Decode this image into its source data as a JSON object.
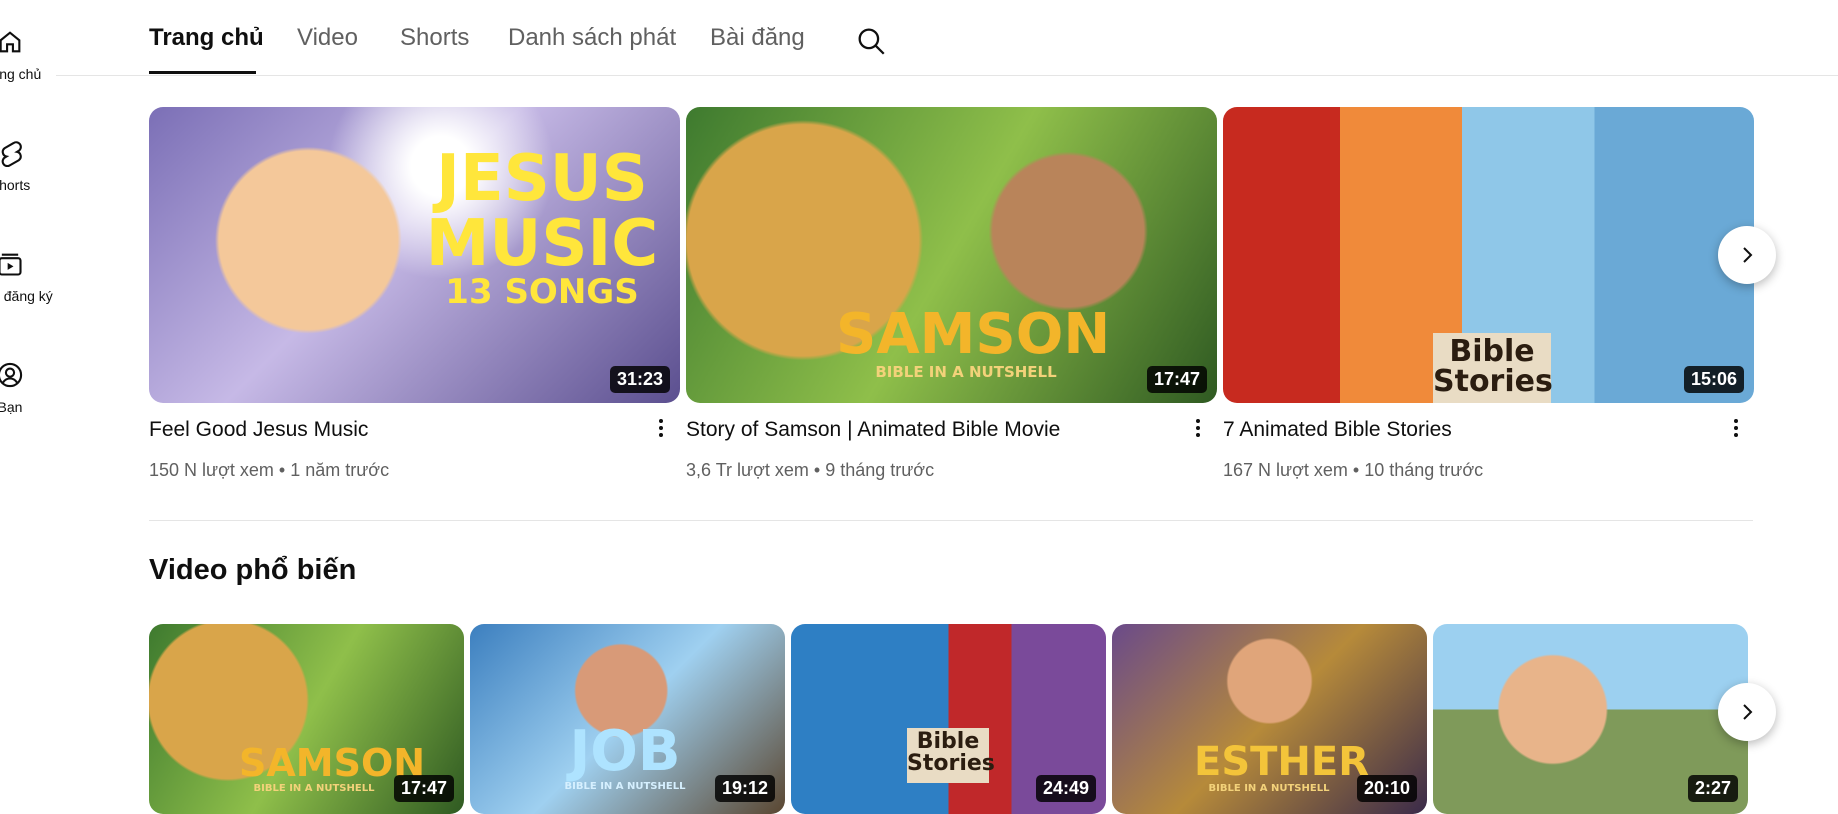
{
  "sidebar": {
    "items": [
      {
        "label": "Trang chủ",
        "icon": "home-icon"
      },
      {
        "label": "Shorts",
        "icon": "shorts-icon"
      },
      {
        "label": "Kênh đăng ký",
        "icon": "subscriptions-icon"
      },
      {
        "label": "Bạn",
        "icon": "you-icon"
      }
    ]
  },
  "tabs": [
    {
      "label": "Trang chủ",
      "active": true
    },
    {
      "label": "Video",
      "active": false
    },
    {
      "label": "Shorts",
      "active": false
    },
    {
      "label": "Danh sách phát",
      "active": false
    },
    {
      "label": "Bài đăng",
      "active": false
    }
  ],
  "featured": [
    {
      "title": "Feel Good Jesus Music",
      "views": "150 N lượt xem",
      "age": "1 năm trước",
      "duration": "31:23",
      "art_line1": "JESUS",
      "art_line2": "MUSIC",
      "art_line3": "13 SONGS"
    },
    {
      "title": "Story of Samson | Animated Bible Movie",
      "views": "3,6 Tr lượt xem",
      "age": "9 tháng trước",
      "duration": "17:47",
      "art_line1": "SAMSON",
      "art_line2": "BIBLE IN A NUTSHELL"
    },
    {
      "title": "7 Animated Bible Stories",
      "views": "167 N lượt xem",
      "age": "10 tháng trước",
      "duration": "15:06",
      "art_line1": "Bible",
      "art_line2": "Stories"
    }
  ],
  "popular": {
    "title": "Video phổ biến",
    "items": [
      {
        "duration": "17:47",
        "art_line1": "SAMSON",
        "art_line2": "BIBLE IN A NUTSHELL"
      },
      {
        "duration": "19:12",
        "art_line1": "JOB",
        "art_line2": "BIBLE IN A NUTSHELL"
      },
      {
        "duration": "24:49",
        "art_line1": "Bible",
        "art_line2": "Stories"
      },
      {
        "duration": "20:10",
        "art_line1": "ESTHER",
        "art_line2": "BIBLE IN A NUTSHELL"
      },
      {
        "duration": "2:27"
      }
    ]
  },
  "colors": {
    "accent": "#0f0f0f",
    "secondary_text": "#606060",
    "divider": "#e5e5e5"
  }
}
